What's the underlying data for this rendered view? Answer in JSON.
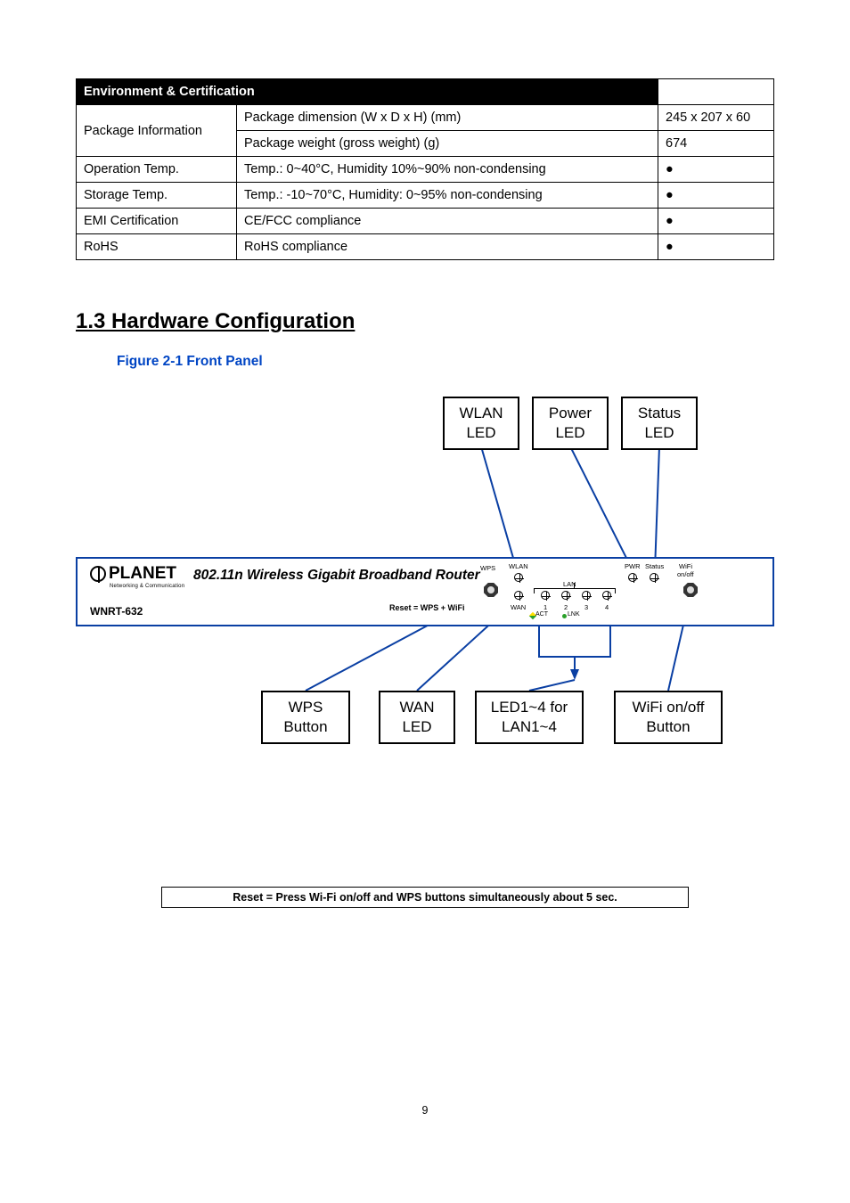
{
  "table": {
    "header": "Environment & Certification",
    "rows": [
      {
        "label": "Package Information",
        "desc": "Package dimension (W x D x H) (mm)",
        "val": "245 x 207 x 60",
        "rowspan": 2
      },
      {
        "label": "",
        "desc": "Package weight (gross weight) (g)",
        "val": "674"
      },
      {
        "label": "Operation Temp.",
        "desc": "Temp.: 0~40°C, Humidity 10%~90% non-condensing",
        "val": "●"
      },
      {
        "label": "Storage Temp.",
        "desc": "Temp.: -10~70°C, Humidity: 0~95% non-condensing",
        "val": "●"
      },
      {
        "label": "EMI Certification",
        "desc": "CE/FCC compliance",
        "val": "●"
      },
      {
        "label": "RoHS",
        "desc": "RoHS compliance",
        "val": "●"
      }
    ]
  },
  "section_title": "1.3 Hardware Configuration",
  "figure_caption": "Figure 2-1 Front Panel",
  "callouts": {
    "wlan": "WLAN LED",
    "power": "Power LED",
    "status": "Status LED",
    "wps": "WPS Button",
    "wan": "WAN LED",
    "lan": "LED1~4 for LAN1~4",
    "wifi": "WiFi on/off Button"
  },
  "router": {
    "brand": "PLANET",
    "brand_sub": "Networking & Communication",
    "title": "802.11n Wireless Gigabit Broadband Router",
    "model": "WNRT-632",
    "reset_label": "Reset = WPS + WiFi",
    "leds": {
      "wps": "WPS",
      "wlan": "WLAN",
      "wan": "WAN",
      "lan": "LAN",
      "n1": "1",
      "n2": "2",
      "n3": "3",
      "n4": "4",
      "pwr": "PWR",
      "status": "Status",
      "wifi": "WiFi",
      "wifion": "on/off",
      "act": "ACT",
      "lnk": "LNK"
    }
  },
  "note": "Reset = Press Wi-Fi on/off and WPS buttons simultaneously about 5 sec.",
  "page_number": "9"
}
